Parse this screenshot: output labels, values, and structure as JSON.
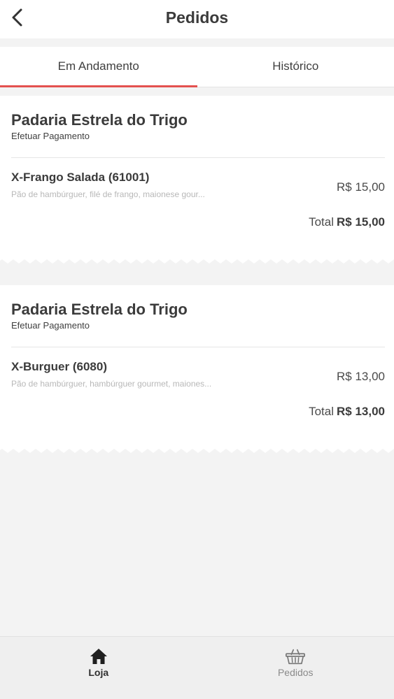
{
  "header": {
    "title": "Pedidos",
    "back_icon": "chevron-left-icon"
  },
  "tabs": [
    {
      "label": "Em Andamento",
      "active": true
    },
    {
      "label": "Histórico",
      "active": false
    }
  ],
  "orders": [
    {
      "store": "Padaria Estrela do Trigo",
      "status": "Efetuar Pagamento",
      "item_name": "X-Frango Salada (61001)",
      "item_desc": "Pão de hambúrguer, filé de frango, maionese gour...",
      "item_price": "R$ 15,00",
      "total_label": "Total",
      "total_value": "R$ 15,00"
    },
    {
      "store": "Padaria Estrela do Trigo",
      "status": "Efetuar Pagamento",
      "item_name": "X-Burguer (6080)",
      "item_desc": "Pão de hambúrguer, hambúrguer gourmet, maiones...",
      "item_price": "R$ 13,00",
      "total_label": "Total",
      "total_value": "R$ 13,00"
    }
  ],
  "bottom_nav": [
    {
      "label": "Loja",
      "icon": "home-icon",
      "active": true
    },
    {
      "label": "Pedidos",
      "icon": "basket-icon",
      "active": false
    }
  ],
  "colors": {
    "accent": "#e4514f",
    "background": "#f3f3f3"
  }
}
